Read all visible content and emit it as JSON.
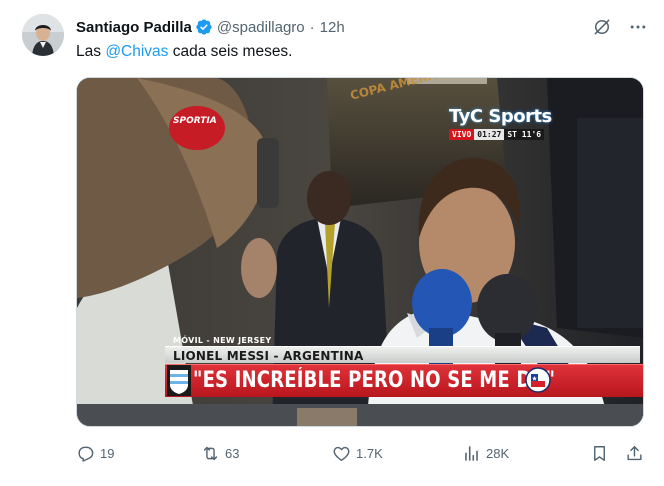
{
  "tweet": {
    "author_name": "Santiago Padilla",
    "handle": "@spadillagro",
    "separator": "·",
    "time": "12h",
    "text_prefix": "Las ",
    "mention": "@Chivas",
    "text_suffix": " cada seis meses."
  },
  "media": {
    "broadcaster": "TyC Sports",
    "live_label": "VIVO",
    "clock": "01:27",
    "half": "ST 11'6",
    "mic_brand": "SPORTIA",
    "backdrop_text": "COPA AMERICA CENTENARIO",
    "location": "MÓVIL - NEW JERSEY",
    "player_caption": "LIONEL MESSI - ARGENTINA",
    "quote": "\"ES INCREÍBLE PERO NO SE ME DA\""
  },
  "actions": {
    "replies": "19",
    "reposts": "63",
    "likes": "1.7K",
    "views": "28K"
  },
  "colors": {
    "accent": "#1d9bf0",
    "text_secondary": "#536471",
    "quote_bar": "#d42a31"
  },
  "icons": {
    "verified": "verified-badge-icon",
    "grok": "grok-icon",
    "more": "more-icon",
    "reply": "reply-icon",
    "repost": "repost-icon",
    "like": "like-icon",
    "views": "views-icon",
    "bookmark": "bookmark-icon",
    "share": "share-icon"
  }
}
